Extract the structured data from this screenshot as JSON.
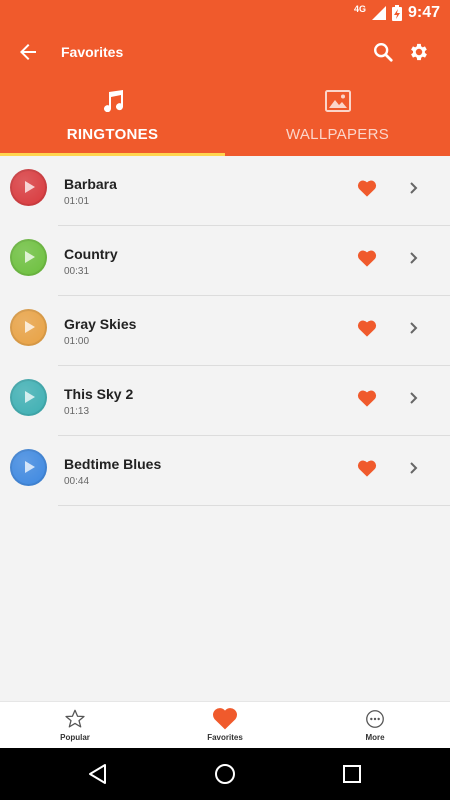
{
  "status": {
    "network": "4G",
    "time": "9:47"
  },
  "appbar": {
    "title": "Favorites"
  },
  "tabs": [
    {
      "label": "RINGTONES",
      "icon": "music-note-icon",
      "active": true
    },
    {
      "label": "WALLPAPERS",
      "icon": "image-icon",
      "active": false
    }
  ],
  "ringtones": [
    {
      "name": "Barbara",
      "duration": "01:01",
      "color": "#d8363a"
    },
    {
      "name": "Country",
      "duration": "00:31",
      "color": "#6abf3a"
    },
    {
      "name": "Gray Skies",
      "duration": "01:00",
      "color": "#e8a040"
    },
    {
      "name": "This Sky 2",
      "duration": "01:13",
      "color": "#3aaeb2"
    },
    {
      "name": "Bedtime Blues",
      "duration": "00:44",
      "color": "#3a86e0"
    }
  ],
  "bottom_nav": [
    {
      "label": "Popular",
      "icon": "star-icon"
    },
    {
      "label": "Favorites",
      "icon": "heart-icon"
    },
    {
      "label": "More",
      "icon": "more-icon"
    }
  ],
  "colors": {
    "primary": "#f05a2c",
    "accent": "#ffd54f",
    "heart": "#f05a2c"
  }
}
